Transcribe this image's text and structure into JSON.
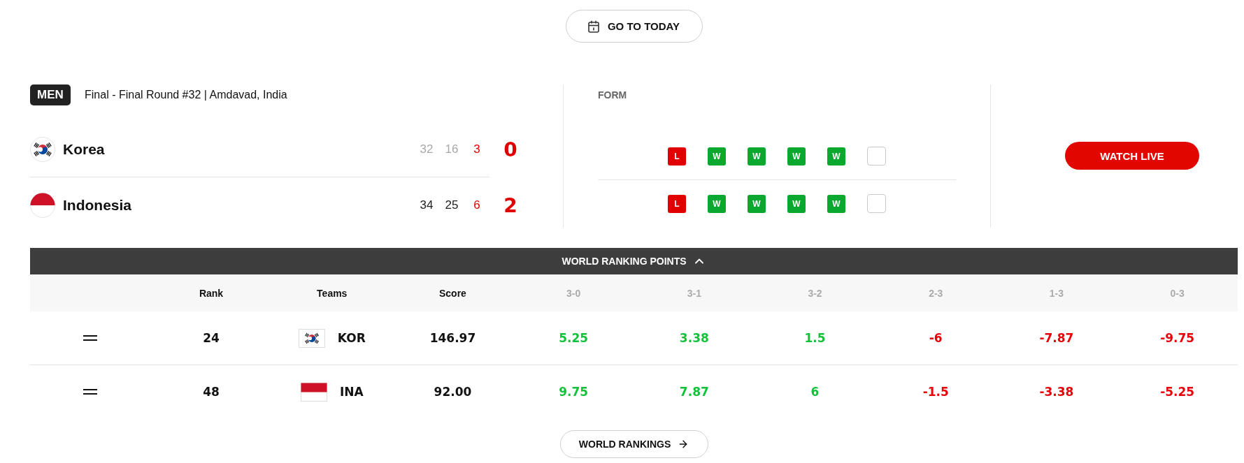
{
  "today_button": {
    "label": "GO TO TODAY"
  },
  "match": {
    "category": "MEN",
    "info": "Final - Final Round #32 | Amdavad, India",
    "teams": [
      {
        "name": "Korea",
        "kind": "korea",
        "sets": [
          {
            "text": "32",
            "kind": "lost"
          },
          {
            "text": "16",
            "kind": "lost"
          },
          {
            "text": "3",
            "kind": "current"
          }
        ],
        "score": "0"
      },
      {
        "name": "Indonesia",
        "kind": "indonesia",
        "sets": [
          {
            "text": "34",
            "kind": "won"
          },
          {
            "text": "25",
            "kind": "won"
          },
          {
            "text": "6",
            "kind": "current"
          }
        ],
        "score": "2"
      }
    ]
  },
  "form": {
    "label": "FORM",
    "rows": [
      {
        "results": [
          {
            "kind": "loss",
            "text": "L"
          },
          {
            "kind": "win",
            "text": "W"
          },
          {
            "kind": "win",
            "text": "W"
          },
          {
            "kind": "win",
            "text": "W"
          },
          {
            "kind": "win",
            "text": "W"
          },
          {
            "kind": "pending"
          }
        ]
      },
      {
        "results": [
          {
            "kind": "loss",
            "text": "L"
          },
          {
            "kind": "win",
            "text": "W"
          },
          {
            "kind": "win",
            "text": "W"
          },
          {
            "kind": "win",
            "text": "W"
          },
          {
            "kind": "win",
            "text": "W"
          },
          {
            "kind": "pending"
          }
        ]
      }
    ]
  },
  "watch_button": {
    "label": "WATCH LIVE"
  },
  "ranking": {
    "title": "WORLD RANKING POINTS",
    "expanded": true,
    "columns": [
      {
        "label": "Rank",
        "kind": "main"
      },
      {
        "label": "Teams",
        "kind": "main"
      },
      {
        "label": "Score",
        "kind": "main"
      },
      {
        "label": "3-0",
        "kind": "result"
      },
      {
        "label": "3-1",
        "kind": "result"
      },
      {
        "label": "3-2",
        "kind": "result"
      },
      {
        "label": "2-3",
        "kind": "result"
      },
      {
        "label": "1-3",
        "kind": "result"
      },
      {
        "label": "0-3",
        "kind": "result"
      }
    ],
    "rows": [
      {
        "rank": "24",
        "team": "KOR",
        "kind": "korea",
        "score": "146.97",
        "points": [
          {
            "text": "5.25",
            "kind": "gain"
          },
          {
            "text": "3.38",
            "kind": "gain"
          },
          {
            "text": "1.5",
            "kind": "gain"
          },
          {
            "text": "-6",
            "kind": "loss"
          },
          {
            "text": "-7.87",
            "kind": "loss"
          },
          {
            "text": "-9.75",
            "kind": "loss"
          }
        ]
      },
      {
        "rank": "48",
        "team": "INA",
        "kind": "indonesia",
        "score": "92.00",
        "points": [
          {
            "text": "9.75",
            "kind": "gain"
          },
          {
            "text": "7.87",
            "kind": "gain"
          },
          {
            "text": "6",
            "kind": "gain"
          },
          {
            "text": "-1.5",
            "kind": "loss"
          },
          {
            "text": "-3.38",
            "kind": "loss"
          },
          {
            "text": "-5.25",
            "kind": "loss"
          }
        ]
      }
    ]
  },
  "rankings_button": {
    "label": "WORLD RANKINGS"
  }
}
